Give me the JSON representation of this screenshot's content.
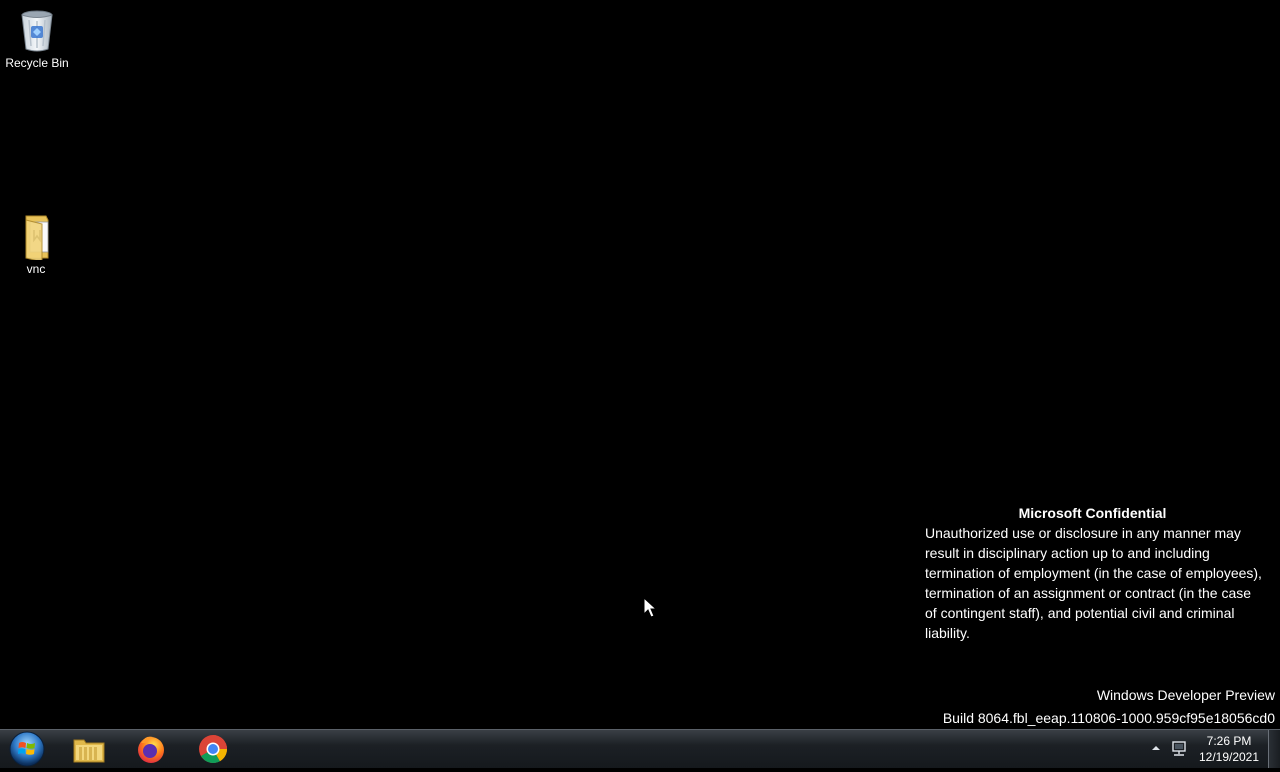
{
  "desktop": {
    "icons": [
      {
        "label": "Recycle Bin",
        "icon": "recycle-bin-icon"
      },
      {
        "label": "vnc",
        "icon": "folder-icon"
      }
    ]
  },
  "watermark": {
    "title": "Microsoft Confidential",
    "body": "Unauthorized use or disclosure in any manner may result in disciplinary action up to and including termination of employment (in the case of employees), termination of an assignment or contract (in the case of contingent staff), and potential civil and criminal liability."
  },
  "build": {
    "line1": "Windows Developer Preview",
    "line2": "Build 8064.fbl_eeap.110806-1000.959cf95e18056cd0"
  },
  "taskbar": {
    "start_icon": "windows-start-orb-icon",
    "apps": [
      {
        "name": "Windows Explorer",
        "icon": "file-explorer-icon"
      },
      {
        "name": "Firefox",
        "icon": "firefox-icon"
      },
      {
        "name": "Google Chrome",
        "icon": "chrome-icon"
      }
    ],
    "tray": {
      "arrow_icon": "show-hidden-icons-arrow-icon",
      "network_icon": "network-icon"
    },
    "clock": {
      "time": "7:26 PM",
      "date": "12/19/2021"
    }
  },
  "colors": {
    "desktop_bg": "#000000",
    "taskbar_bg": "#1c2025",
    "text": "#ffffff"
  }
}
